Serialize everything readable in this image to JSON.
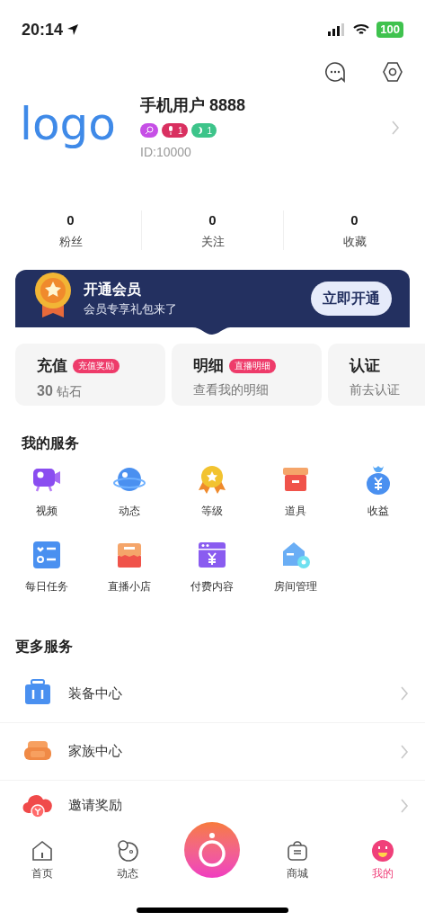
{
  "status_bar": {
    "time": "20:14",
    "battery": "100"
  },
  "profile": {
    "logo": "logo",
    "name": "手机用户 8888",
    "id": "ID:10000",
    "badges": [
      {
        "kind": "chat",
        "color": "#c64fe6"
      },
      {
        "kind": "mic",
        "color": "#d93060",
        "text": "1"
      },
      {
        "kind": "moon",
        "color": "#3dc48a",
        "text": "1"
      }
    ]
  },
  "stats": [
    {
      "value": "0",
      "label": "粉丝"
    },
    {
      "value": "0",
      "label": "关注"
    },
    {
      "value": "0",
      "label": "收藏"
    }
  ],
  "vip_banner": {
    "title": "开通会员",
    "subtitle": "会员专享礼包来了",
    "button": "立即开通"
  },
  "cards": [
    {
      "title": "充值",
      "tag": "充值奖励",
      "subtitle": "**30** 钻石"
    },
    {
      "title": "明细",
      "tag": "直播明细",
      "subtitle": "查看我的明细"
    },
    {
      "title": "认证",
      "subtitle": "前去认证"
    }
  ],
  "my_services": {
    "title": "我的服务",
    "items": [
      {
        "kind": "video",
        "label": "视频"
      },
      {
        "kind": "planet",
        "label": "动态"
      },
      {
        "kind": "medal",
        "label": "等级"
      },
      {
        "kind": "box",
        "label": "道具"
      },
      {
        "kind": "moneybag",
        "label": "收益"
      },
      {
        "kind": "checklist",
        "label": "每日任务"
      },
      {
        "kind": "shop",
        "label": "直播小店"
      },
      {
        "kind": "paid",
        "label": "付费内容"
      },
      {
        "kind": "house",
        "label": "房间管理"
      }
    ]
  },
  "more_services": {
    "title": "更多服务",
    "items": [
      {
        "kind": "suitcase",
        "label": "装备中心"
      },
      {
        "kind": "sofa",
        "label": "家族中心"
      },
      {
        "kind": "cloud",
        "label": "邀请奖励"
      }
    ]
  },
  "tab_bar": [
    {
      "kind": "home",
      "label": "首页",
      "selected": false
    },
    {
      "kind": "moments",
      "label": "动态",
      "selected": false
    },
    {
      "kind": "camera",
      "selected": false
    },
    {
      "kind": "shop",
      "label": "商城",
      "selected": false
    },
    {
      "kind": "me",
      "label": "我的",
      "selected": true
    }
  ]
}
